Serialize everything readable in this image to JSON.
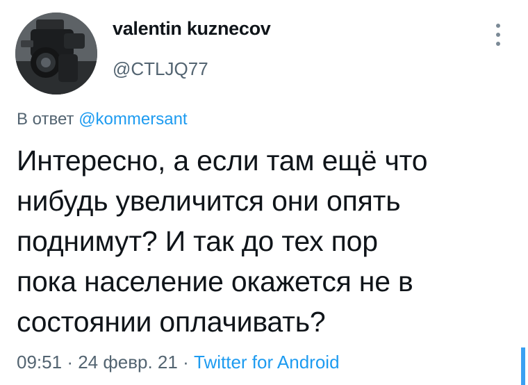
{
  "user": {
    "display_name": "valentin kuznecov",
    "handle": "@CTLJQ77"
  },
  "reply": {
    "prefix": "В ответ",
    "mention": "@kommersant"
  },
  "tweet": {
    "lines": [
      "Интересно, а если там ещё что",
      "нибудь увеличится они опять",
      "поднимут? И так до тех пор",
      "пока население окажется не в",
      "состоянии оплачивать?"
    ]
  },
  "meta": {
    "time": "09:51",
    "separator": "·",
    "date": "24 февр. 21",
    "source": "Twitter for Android"
  },
  "icons": {
    "more": "more-vertical-icon",
    "avatar": "camera-avatar"
  },
  "colors": {
    "link": "#1d9bf0",
    "secondary_text": "#536471",
    "primary_text": "#0f1419"
  }
}
